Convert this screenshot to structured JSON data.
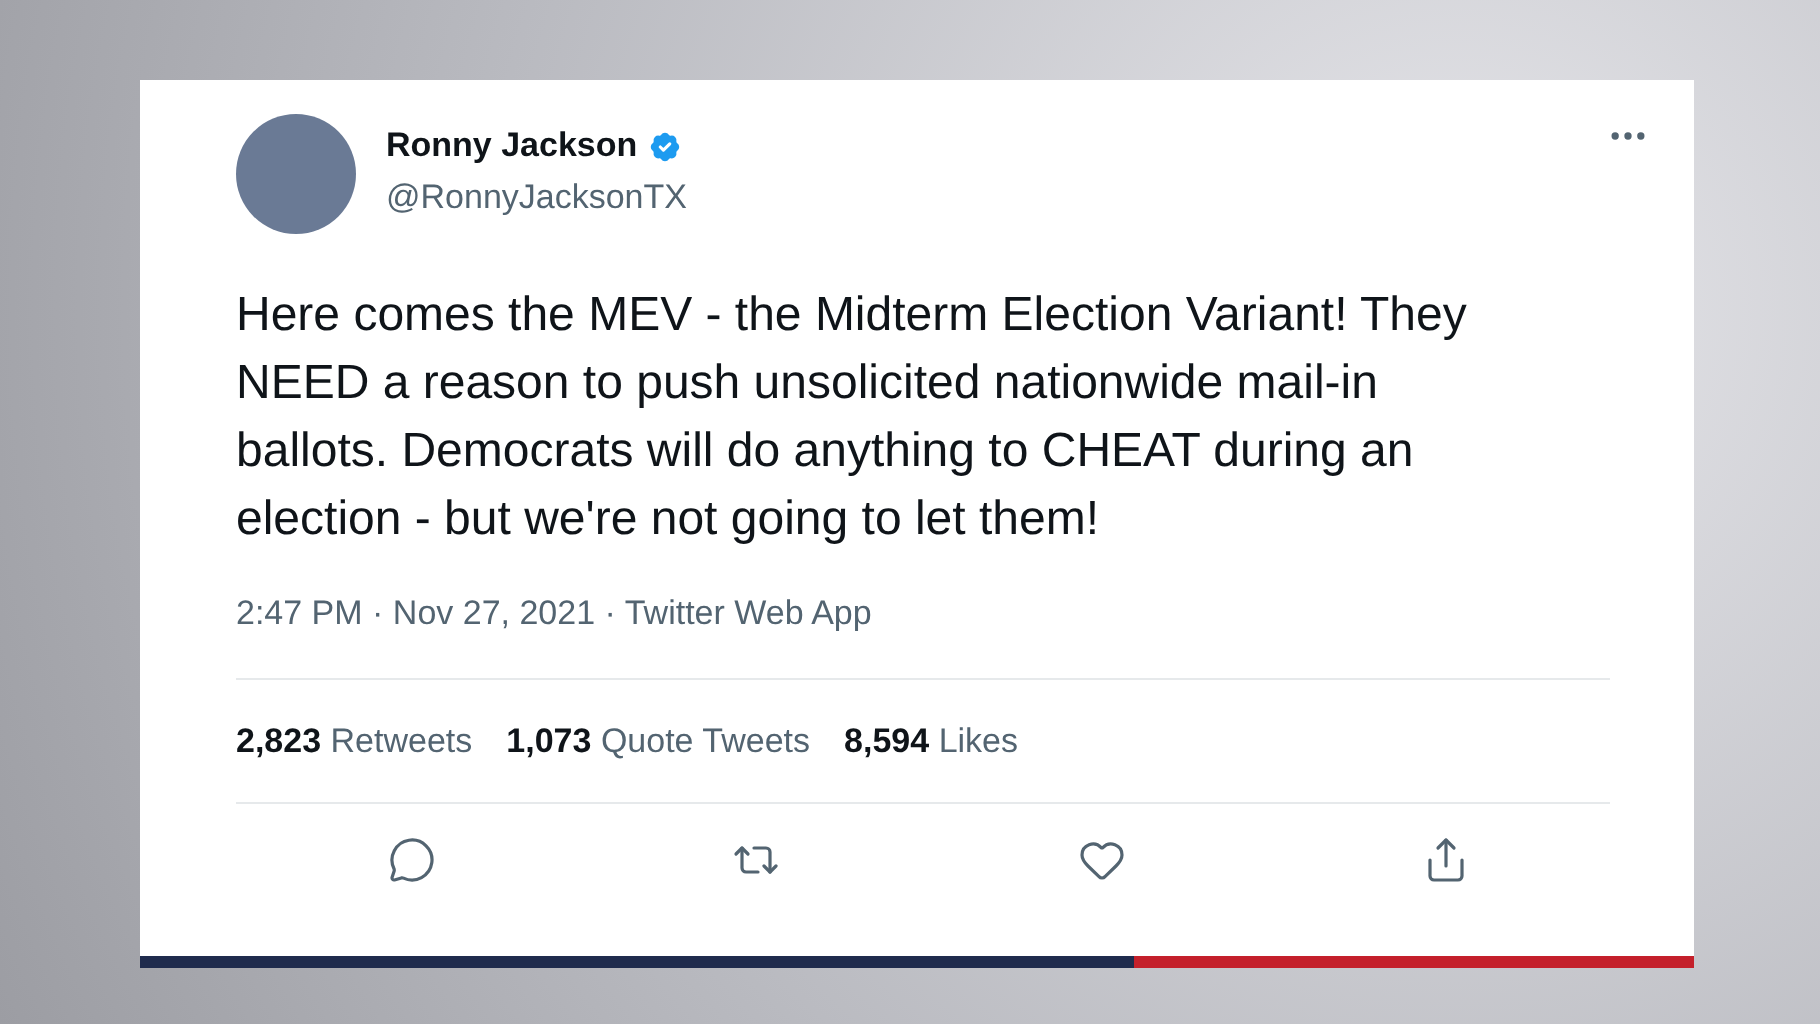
{
  "tweet": {
    "author": {
      "name": "Ronny Jackson",
      "handle": "@RonnyJacksonTX",
      "verified": true
    },
    "text": "Here comes the MEV - the Midterm Election Variant! They NEED a reason to push unsolicited nationwide mail-in ballots. Democrats will do anything to CHEAT during an election - but we're not going to let them!",
    "meta": "2:47 PM · Nov 27, 2021 · Twitter Web App",
    "stats": [
      {
        "count": "2,823",
        "label": "Retweets"
      },
      {
        "count": "1,073",
        "label": "Quote Tweets"
      },
      {
        "count": "8,594",
        "label": "Likes"
      }
    ],
    "actions": [
      {
        "kind": "reply"
      },
      {
        "kind": "retweet"
      },
      {
        "kind": "like"
      },
      {
        "kind": "share"
      }
    ]
  }
}
